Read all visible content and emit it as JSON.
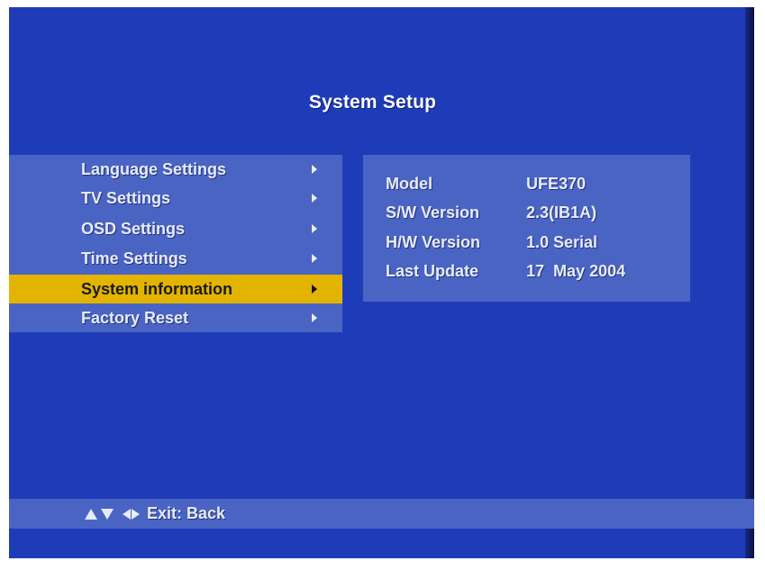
{
  "screen": {
    "title": "System Setup"
  },
  "menu": {
    "items": [
      {
        "label": "Language Settings"
      },
      {
        "label": "TV Settings"
      },
      {
        "label": "OSD Settings"
      },
      {
        "label": "Time Settings"
      },
      {
        "label": "System information"
      },
      {
        "label": "Factory Reset"
      }
    ],
    "selected_index": 4
  },
  "info": {
    "model_label": "Model",
    "model_value": "UFE370",
    "sw_label": "S/W Version",
    "sw_value": "2.3(IB1A)",
    "hw_label": "H/W Version",
    "hw_value": "1.0 Serial",
    "update_label": "Last Update",
    "update_value": "17  May 2004"
  },
  "help": {
    "nav_icons": [
      "up-arrow-icon",
      "down-arrow-icon",
      "left-arrow-icon",
      "right-arrow-icon"
    ],
    "text": "Exit: Back"
  },
  "colors": {
    "background": "#1f3cb8",
    "panel": "#4a64c4",
    "highlight": "#e2b400",
    "text": "#e8ecf8"
  }
}
